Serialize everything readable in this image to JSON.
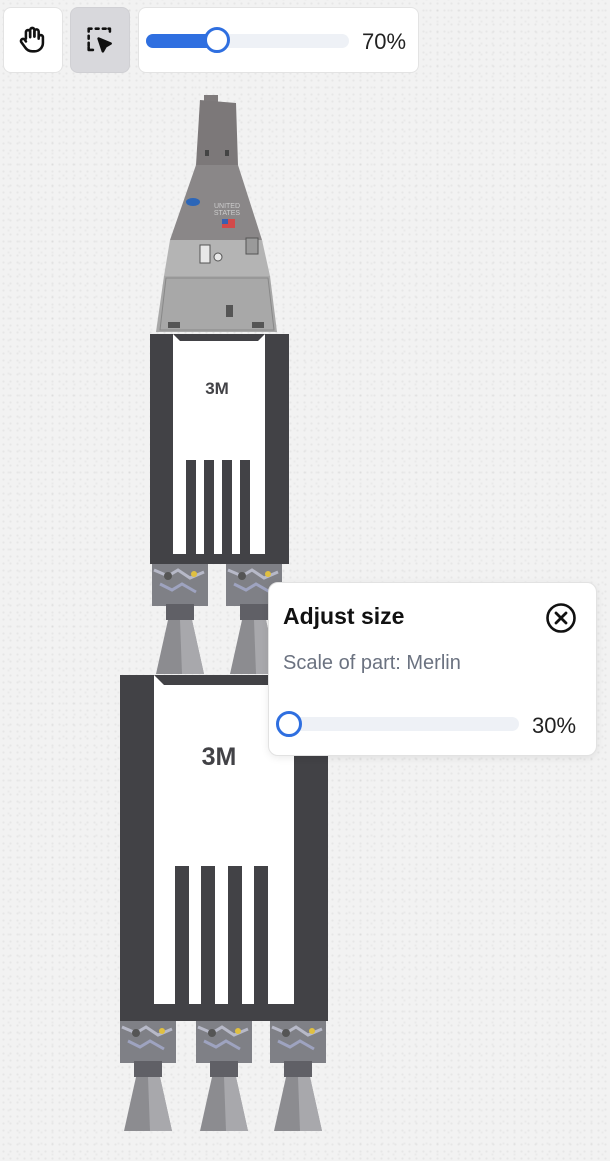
{
  "toolbar": {
    "hand_tool": {
      "icon": "hand-icon"
    },
    "select_tool": {
      "icon": "select-cursor-icon",
      "active": true
    },
    "zoom": {
      "value": 0.7,
      "label": "70%"
    }
  },
  "rocket": {
    "capsule": {
      "label_line1": "UNITED",
      "label_line2": "STATES"
    },
    "upper_stage": {
      "label": "3M"
    },
    "lower_stage": {
      "label": "3M"
    }
  },
  "popover": {
    "title": "Adjust size",
    "subtitle": "Scale of part: Merlin",
    "close_icon": "close-circle-icon",
    "slider": {
      "value": 0.3,
      "label": "30%"
    }
  },
  "colors": {
    "accent": "#2f6fe0",
    "stage_dark": "#424246",
    "capsule_gray": "#9a9a9a"
  }
}
